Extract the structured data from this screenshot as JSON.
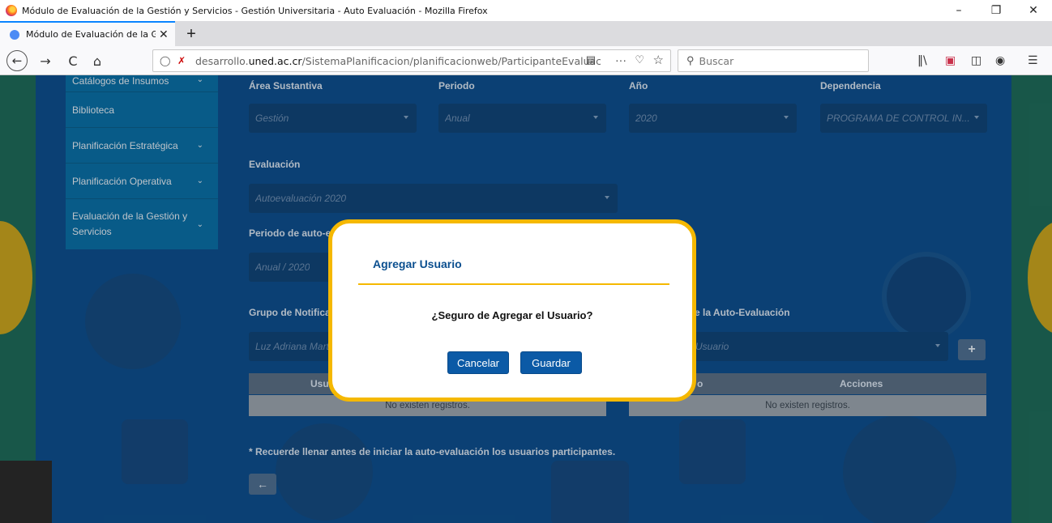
{
  "window": {
    "title": "Módulo de Evaluación de la Gestión y Servicios - Gestión Universitaria - Auto Evaluación - Mozilla Firefox",
    "minimize": "–",
    "restore": "❐",
    "close": "✕"
  },
  "tab": {
    "label": "Módulo de Evaluación de la Ge",
    "close": "✕",
    "new_tab": "+"
  },
  "navbar": {
    "back": "←",
    "forward": "→",
    "reload": "C",
    "home": "⌂",
    "url_prefix": "desarrollo.",
    "url_domain": "uned.ac.cr",
    "url_path": "/SistemaPlanificacion/planificacionweb/ParticipanteEvaluacio",
    "more": "···",
    "search_placeholder": "Buscar"
  },
  "sidebar": {
    "items": [
      {
        "label": "Catálogos de Insumos",
        "chevron": "⌄"
      },
      {
        "label": "Biblioteca",
        "chevron": ""
      },
      {
        "label": "Planificación Estratégica",
        "chevron": "⌄"
      },
      {
        "label": "Planificación Operativa",
        "chevron": "⌄"
      },
      {
        "label": "Evaluación de la Gestión y Servicios",
        "chevron": "⌄"
      }
    ]
  },
  "form": {
    "area_label": "Área Sustantiva",
    "area_value": "Gestión",
    "periodo_label": "Periodo",
    "periodo_value": "Anual",
    "anio_label": "Año",
    "anio_value": "2020",
    "dependencia_label": "Dependencia",
    "dependencia_value": "PROGRAMA DE CONTROL IN...",
    "evaluacion_label": "Evaluación",
    "evaluacion_value": "Autoevaluación 2020",
    "periodo_auto_label": "Periodo de auto-eva",
    "periodo_auto_value": "Anual / 2020",
    "grupo_label": "Grupo de Notificac",
    "grupo_value": "Luz Adriana Mart",
    "usuarios_label": "e la Auto-Evaluación",
    "usuarios_value": "Usuario",
    "plus": "+"
  },
  "tables": {
    "left_header": "Usua",
    "left_empty": "No existen registros.",
    "right_header_col1": "o",
    "right_header_col2": "Acciones",
    "right_empty": "No existen registros."
  },
  "note": "* Recuerde llenar antes de iniciar la auto-evaluación los usuarios participantes.",
  "back_button": "←",
  "modal": {
    "title": "Agregar Usuario",
    "message": "¿Seguro de Agregar el Usuario?",
    "cancel": "Cancelar",
    "save": "Guardar"
  },
  "colors": {
    "accent_border": "#f5b800",
    "primary_button": "#0b5aa6",
    "modal_title": "#0b4f8f",
    "page_background": "#0e4f8e"
  }
}
